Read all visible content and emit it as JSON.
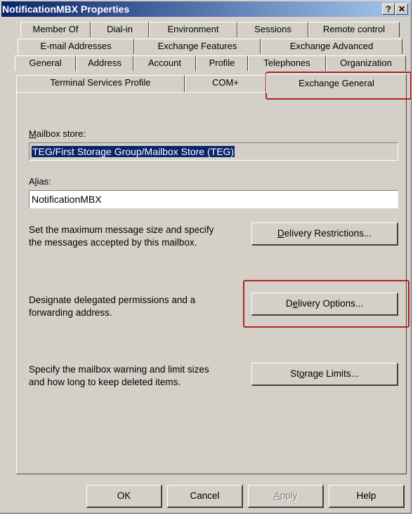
{
  "window": {
    "title": "NotificationMBX Properties",
    "help_glyph": "?",
    "close_glyph": "✕"
  },
  "tabs": {
    "row1": [
      "Member Of",
      "Dial-in",
      "Environment",
      "Sessions",
      "Remote control"
    ],
    "row2": [
      "E-mail Addresses",
      "Exchange Features",
      "Exchange Advanced"
    ],
    "row3": [
      "General",
      "Address",
      "Account",
      "Profile",
      "Telephones",
      "Organization"
    ],
    "row4": [
      "Terminal Services Profile",
      "COM+",
      "Exchange General"
    ],
    "active": "Exchange General"
  },
  "mailbox_store": {
    "label_key": "M",
    "label_rest": "ailbox store:",
    "value": "TEG/First Storage Group/Mailbox Store (TEG)"
  },
  "alias": {
    "label_a": "A",
    "label_key": "l",
    "label_rest": "ias:",
    "value": "NotificationMBX"
  },
  "sections": {
    "restrictions": {
      "desc_line1": "Set the maximum message size and specify",
      "desc_line2": "the messages accepted by this mailbox.",
      "btn_key": "D",
      "btn_rest": "elivery Restrictions..."
    },
    "options": {
      "desc_line1": "Designate delegated permissions and a",
      "desc_line2": "forwarding address.",
      "btn_pre": "D",
      "btn_key": "e",
      "btn_rest": "livery Options..."
    },
    "storage": {
      "desc_line1": "Specify the mailbox warning and limit sizes",
      "desc_line2": "and how long to keep deleted items.",
      "btn_pre": "St",
      "btn_key": "o",
      "btn_rest": "rage Limits..."
    }
  },
  "footer": {
    "ok": "OK",
    "cancel": "Cancel",
    "apply_key": "A",
    "apply_rest": "pply",
    "help": "Help"
  },
  "colors": {
    "accent_box": "#b32025",
    "selection": "#0a246a"
  }
}
